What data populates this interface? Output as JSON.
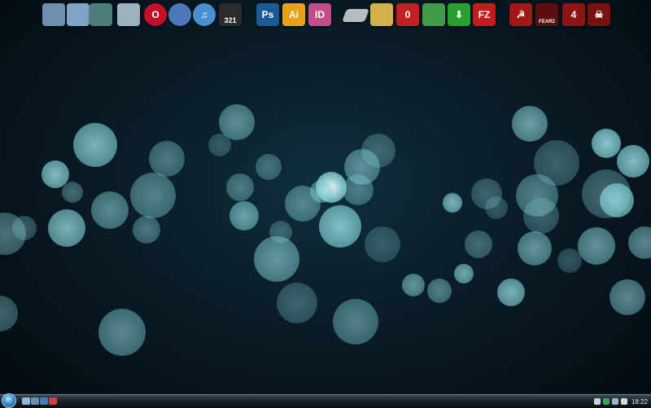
{
  "desktop": {
    "wallpaper_colors": [
      "#0a1e29",
      "#9fe6ee",
      "#3d8f98"
    ],
    "dock_icons": [
      {
        "name": "computer-icon",
        "text": "",
        "color": "#6d8fb0"
      },
      {
        "name": "network-icon",
        "text": "",
        "color": "#7ea4c8"
      },
      {
        "name": "documents-icon",
        "text": "",
        "color": "#4d7f7a"
      },
      {
        "name": "recycle-bin-icon",
        "text": "",
        "color": "#9db4c0"
      },
      {
        "name": "opera-icon",
        "text": "O",
        "color": "#c0102a"
      },
      {
        "name": "thunderbird-icon",
        "text": "",
        "color": "#4a78b8"
      },
      {
        "name": "itunes-icon",
        "text": "♫",
        "color": "#4a8fd0"
      },
      {
        "name": "media-player-icon",
        "text": "321",
        "color": "#2b2b2b"
      },
      {
        "name": "photoshop-icon",
        "text": "Ps",
        "color": "#1a5a96"
      },
      {
        "name": "illustrator-icon",
        "text": "Ai",
        "color": "#e8a21a"
      },
      {
        "name": "indesign-icon",
        "text": "ID",
        "color": "#c24d8a"
      },
      {
        "name": "drive-icon",
        "text": "",
        "color": "#b8bcc0"
      },
      {
        "name": "tool-icon",
        "text": "",
        "color": "#d2b04a"
      },
      {
        "name": "red-tool-icon",
        "text": "0",
        "color": "#c02020"
      },
      {
        "name": "card-icon",
        "text": "",
        "color": "#3f9a4a"
      },
      {
        "name": "download-icon",
        "text": "⬇",
        "color": "#28a030"
      },
      {
        "name": "filezilla-icon",
        "text": "FZ",
        "color": "#c21c1c"
      },
      {
        "name": "soviet-game-icon",
        "text": "☭",
        "color": "#a01818"
      },
      {
        "name": "fear2-icon",
        "text": "FEAR2",
        "color": "#5a0f0f"
      },
      {
        "name": "left4dead-icon",
        "text": "4",
        "color": "#8c1414"
      },
      {
        "name": "skull-game-icon",
        "text": "☠",
        "color": "#7a1010"
      }
    ]
  },
  "taskbar": {
    "clock": "18:22",
    "quick_launch": [
      {
        "name": "show-desktop-icon",
        "color": "#8fb7d8"
      },
      {
        "name": "switch-windows-icon",
        "color": "#6f8fa8"
      },
      {
        "name": "ie-icon",
        "color": "#3f7fc0"
      },
      {
        "name": "media-icon",
        "color": "#d04040"
      }
    ],
    "tray_icons": [
      {
        "name": "tray-arrow-icon",
        "color": "#c8d4dc"
      },
      {
        "name": "tray-shield-icon",
        "color": "#3fa050"
      },
      {
        "name": "tray-network-icon",
        "color": "#9fb4c4"
      },
      {
        "name": "tray-volume-icon",
        "color": "#d0d8de"
      }
    ]
  }
}
